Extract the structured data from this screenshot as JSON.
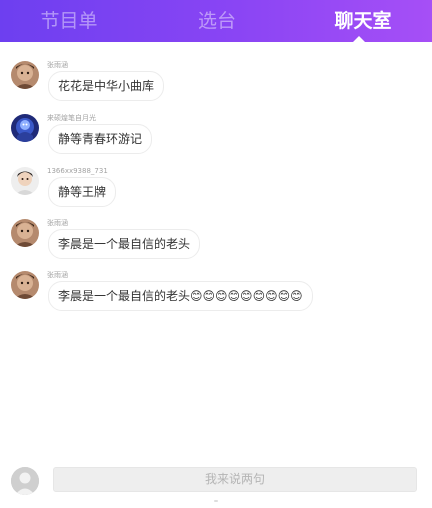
{
  "tabs": [
    {
      "label": "节目单",
      "active": false
    },
    {
      "label": "选台",
      "active": false
    },
    {
      "label": "聊天室",
      "active": true
    }
  ],
  "messages": [
    {
      "sender": "张雨涵",
      "text": "花花是中华小曲库",
      "avatar_icon": "user-avatar-icon"
    },
    {
      "sender": "来硕煌笔自月光",
      "text": "静等青春环游记",
      "avatar_icon": "user-avatar-icon"
    },
    {
      "sender": "1366xx9388_731",
      "text": "静等王牌",
      "avatar_icon": "user-avatar-icon"
    },
    {
      "sender": "张雨涵",
      "text": "李晨是一个最自信的老头",
      "avatar_icon": "user-avatar-icon"
    },
    {
      "sender": "张雨涵",
      "text": "李晨是一个最自信的老头",
      "emoji": "😊😊😊😊😊😊😊😊😊",
      "avatar_icon": "user-avatar-icon"
    }
  ],
  "composer": {
    "placeholder": "我来说两句",
    "avatar_icon": "user-avatar-icon"
  },
  "colors": {
    "header_start": "#6d3ff0",
    "header_end": "#a64ff6",
    "tab_inactive": "rgba(255,255,255,0.45)",
    "tab_active": "#ffffff"
  }
}
